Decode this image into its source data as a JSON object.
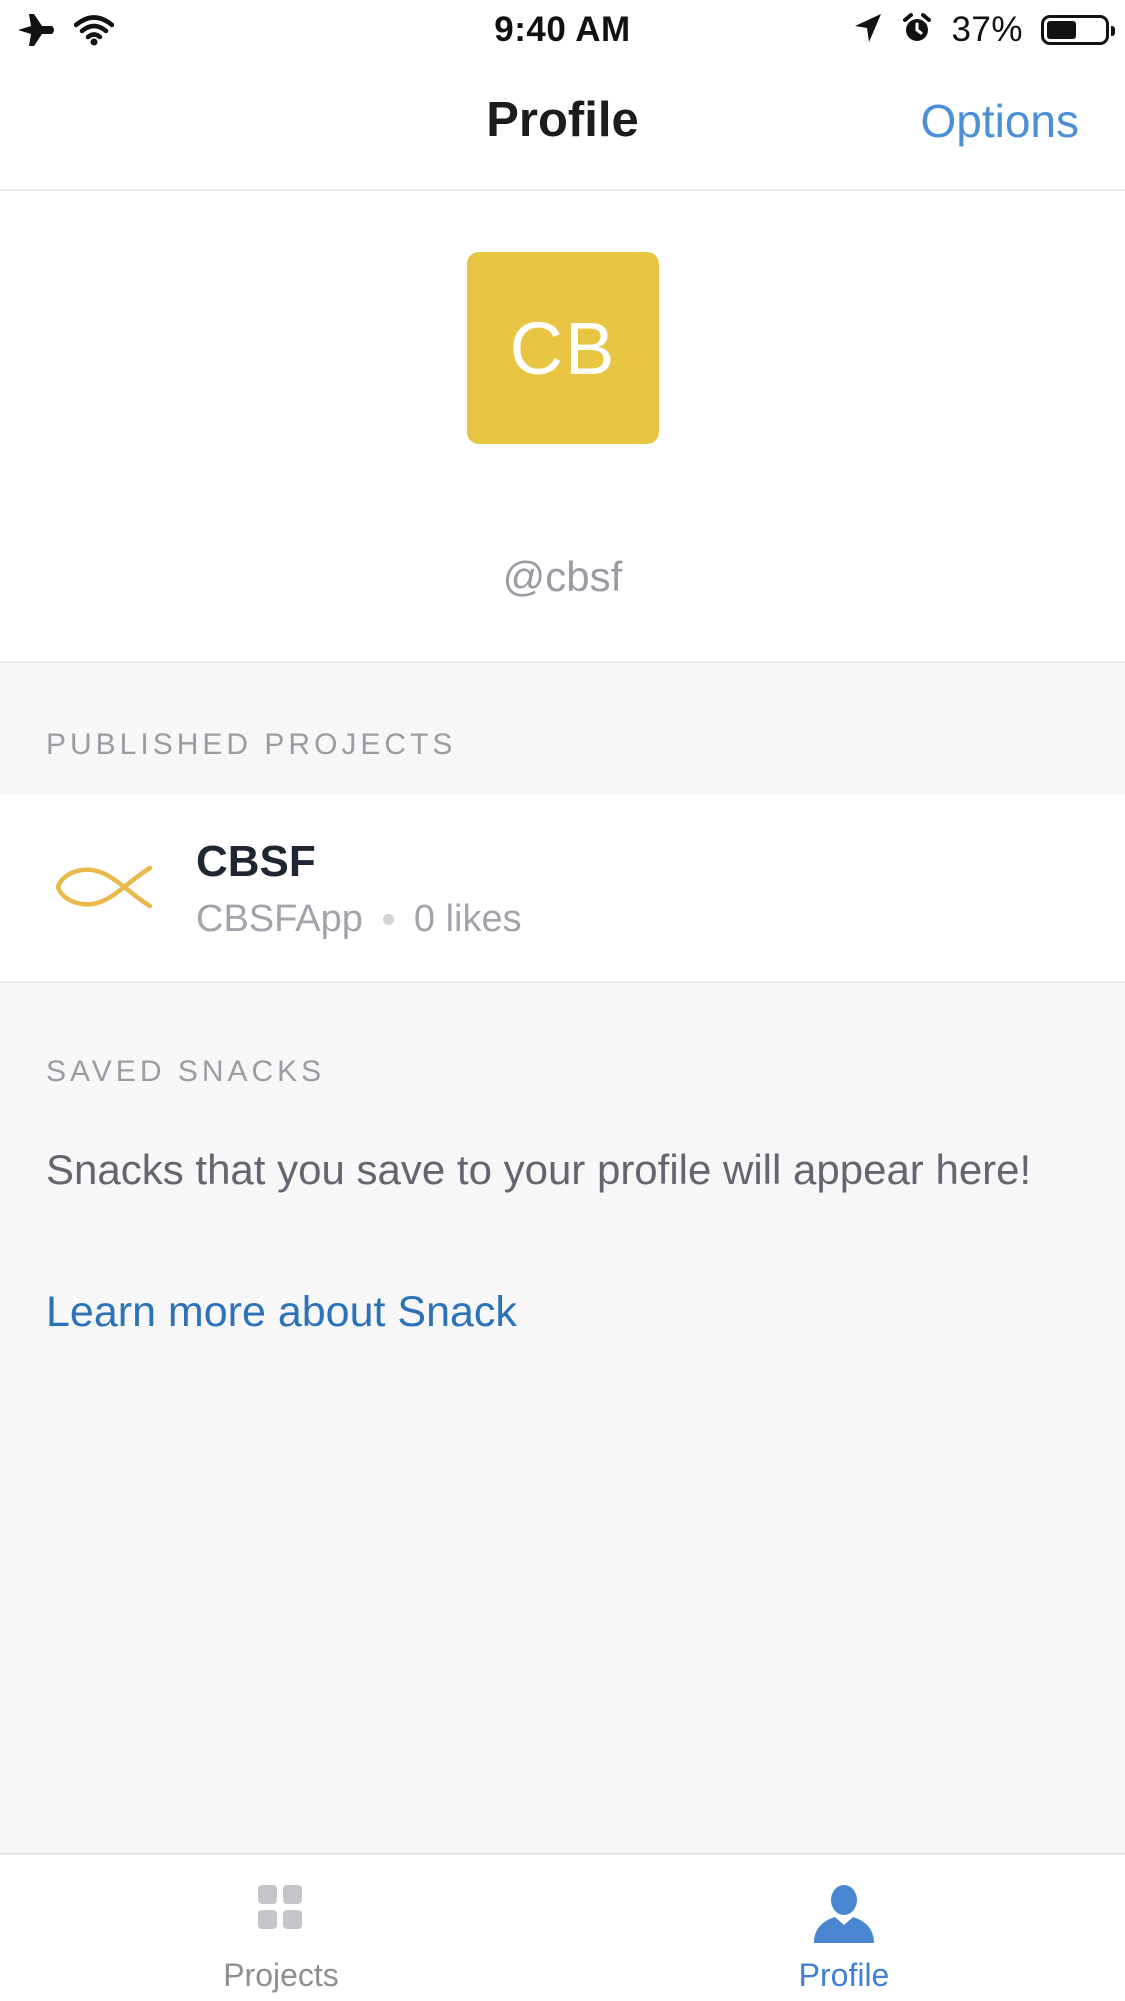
{
  "status_bar": {
    "time": "9:40 AM",
    "battery_text": "37%",
    "battery_level": 0.37,
    "icons": [
      "airplane-mode-icon",
      "wifi-icon",
      "location-arrow-icon",
      "alarm-icon",
      "battery-icon"
    ]
  },
  "nav": {
    "title": "Profile",
    "options_label": "Options"
  },
  "profile": {
    "avatar_initials": "CB",
    "avatar_color": "#E8C443",
    "username": "@cbsf"
  },
  "published_projects": {
    "header": "Published Projects",
    "items": [
      {
        "name": "CBSF",
        "slug": "CBSFApp",
        "likes": "0 likes",
        "icon": "fish-icon",
        "icon_color": "#E8B94A"
      }
    ]
  },
  "saved_snacks": {
    "header": "Saved Snacks",
    "empty_text": "Snacks that you save to your profile will appear here!",
    "learn_more_label": "Learn more about Snack"
  },
  "tab_bar": {
    "tabs": [
      {
        "label": "Projects",
        "icon": "grid-icon",
        "active": false
      },
      {
        "label": "Profile",
        "icon": "person-icon",
        "active": true
      }
    ],
    "active_color": "#3F7FD6",
    "inactive_color": "#8E8F93"
  }
}
